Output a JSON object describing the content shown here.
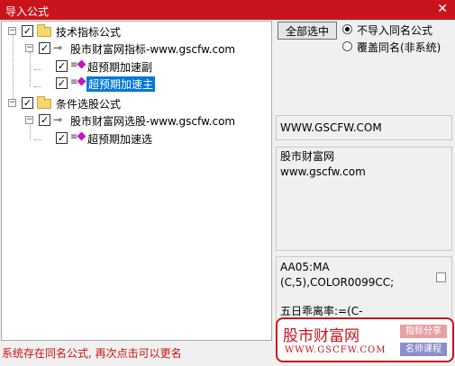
{
  "window": {
    "title": "导入公式",
    "close_glyph": "✕"
  },
  "tree": {
    "groups": [
      {
        "label": "技术指标公式",
        "checked": true,
        "item": {
          "label": "股市财富网指标-www.gscfw.com",
          "children": [
            {
              "label": "超预期加速副",
              "selected": false
            },
            {
              "label": "超预期加速主",
              "selected": true
            }
          ]
        }
      },
      {
        "label": "条件选股公式",
        "checked": true,
        "item": {
          "label": "股市财富网选股-www.gscfw.com",
          "children": [
            {
              "label": "超预期加速选",
              "selected": false
            }
          ]
        }
      }
    ],
    "expander_glyph": "−",
    "check_glyph": "✓"
  },
  "controls": {
    "select_all_label": "全部选中",
    "radio_options": [
      {
        "label": "不导入同名公式",
        "selected": true
      },
      {
        "label": "覆盖同名(非系统)",
        "selected": false
      }
    ]
  },
  "panels": {
    "site": "WWW.GSCFW.COM",
    "desc_lines": [
      "股市财富网",
      "www.gscfw.com"
    ],
    "code_lines": [
      "AA05:MA",
      "(C,5),COLOR0099CC;",
      "",
      "五日乖离率:=(C-"
    ]
  },
  "status": {
    "message": "系统存在同名公式, 再次点击可以更名"
  },
  "watermark": {
    "name": "股市财富网",
    "url": "WWW.GSCFW.COM",
    "tag1": "指标分享",
    "tag2": "名师课程"
  },
  "colors": {
    "title_bar": "#c9141d",
    "selection": "#0078d7",
    "status_text": "#d01010",
    "formula_icon": "#c218c2"
  },
  "icons": {
    "group": "folder-icon",
    "item": "key-icon",
    "formula": "formula-icon"
  }
}
